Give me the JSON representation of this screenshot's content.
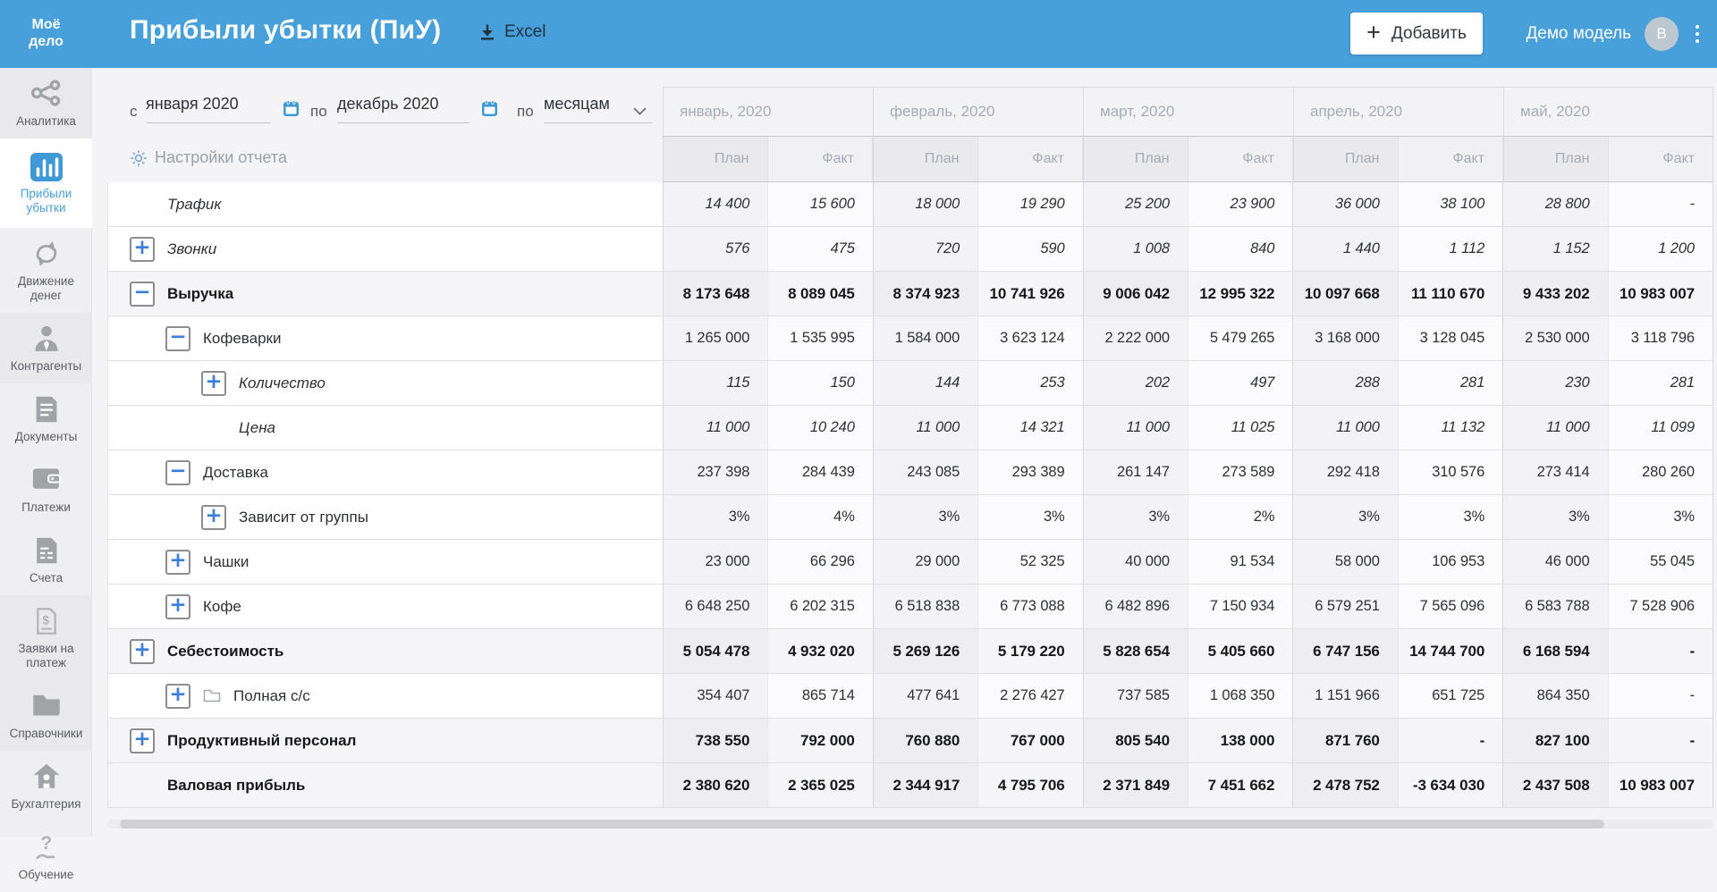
{
  "colors": {
    "header_blue": "#47a0d9",
    "active_blue": "#3f99d6",
    "control_blue": "#3b7fd9"
  },
  "header": {
    "logo_line1": "Моё",
    "logo_line2": "дело",
    "title": "Прибыли убытки (ПиУ)",
    "excel_label": "Excel",
    "add_button_label": "Добавить",
    "account_name": "Демо модель",
    "avatar_letter": "В"
  },
  "sidebar": {
    "items": [
      {
        "label": "Аналитика",
        "icon": "analytics-icon",
        "active": false,
        "tone": "dark"
      },
      {
        "label": "Прибыли убытки",
        "icon": "bar-chart-icon",
        "active": true,
        "tone": "light"
      },
      {
        "label": "Движение денег",
        "icon": "money-flow-icon",
        "active": false,
        "tone": "light"
      },
      {
        "label": "Контрагенты",
        "icon": "counterparty-icon",
        "active": false,
        "tone": "dark"
      },
      {
        "label": "Документы",
        "icon": "documents-icon",
        "active": false,
        "tone": "light"
      },
      {
        "label": "Платежи",
        "icon": "wallet-icon",
        "active": false,
        "tone": "light"
      },
      {
        "label": "Счета",
        "icon": "invoice-icon",
        "active": false,
        "tone": "light"
      },
      {
        "label": "Заявки на платеж",
        "icon": "payment-request-icon",
        "active": false,
        "tone": "dark"
      },
      {
        "label": "Справочники",
        "icon": "folder-icon",
        "active": false,
        "tone": "dark"
      },
      {
        "label": "Бухгалтерия",
        "icon": "accounting-icon",
        "active": false,
        "tone": "light"
      },
      {
        "label": "Обучение",
        "icon": "education-icon",
        "active": false,
        "tone": "light",
        "pinned_bottom": true
      }
    ]
  },
  "filters": {
    "from_label": "с",
    "from_value": "января 2020",
    "to_label": "по",
    "to_value": "декабрь 2020",
    "period_label": "по",
    "period_value": "месяцам",
    "settings_label": "Настройки отчета"
  },
  "table": {
    "months": [
      "январь, 2020",
      "февраль, 2020",
      "март, 2020",
      "апрель, 2020",
      "май, 2020"
    ],
    "subheaders": [
      "План",
      "Факт"
    ],
    "rows": [
      {
        "label": "Трафик",
        "level": 0,
        "expand": null,
        "italic": true,
        "bold": false,
        "folder": false,
        "values": [
          "14 400",
          "15 600",
          "18 000",
          "19 290",
          "25 200",
          "23 900",
          "36 000",
          "38 100",
          "28 800",
          "-"
        ]
      },
      {
        "label": "Звонки",
        "level": 0,
        "expand": "plus",
        "italic": true,
        "bold": false,
        "folder": false,
        "values": [
          "576",
          "475",
          "720",
          "590",
          "1 008",
          "840",
          "1 440",
          "1 112",
          "1 152",
          "1 200"
        ]
      },
      {
        "label": "Выручка",
        "level": 0,
        "expand": "minus",
        "italic": false,
        "bold": true,
        "folder": false,
        "values": [
          "8 173 648",
          "8 089 045",
          "8 374 923",
          "10 741 926",
          "9 006 042",
          "12 995 322",
          "10 097 668",
          "11 110 670",
          "9 433 202",
          "10 983 007"
        ]
      },
      {
        "label": "Кофеварки",
        "level": 1,
        "expand": "minus",
        "italic": false,
        "bold": false,
        "folder": false,
        "values": [
          "1 265 000",
          "1 535 995",
          "1 584 000",
          "3 623 124",
          "2 222 000",
          "5 479 265",
          "3 168 000",
          "3 128 045",
          "2 530 000",
          "3 118 796"
        ]
      },
      {
        "label": "Количество",
        "level": 2,
        "expand": "plus",
        "italic": true,
        "bold": false,
        "folder": false,
        "values": [
          "115",
          "150",
          "144",
          "253",
          "202",
          "497",
          "288",
          "281",
          "230",
          "281"
        ]
      },
      {
        "label": "Цена",
        "level": 2,
        "expand": null,
        "italic": true,
        "bold": false,
        "folder": false,
        "values": [
          "11 000",
          "10 240",
          "11 000",
          "14 321",
          "11 000",
          "11 025",
          "11 000",
          "11 132",
          "11 000",
          "11 099"
        ]
      },
      {
        "label": "Доставка",
        "level": 1,
        "expand": "minus",
        "italic": false,
        "bold": false,
        "folder": false,
        "values": [
          "237 398",
          "284 439",
          "243 085",
          "293 389",
          "261 147",
          "273 589",
          "292 418",
          "310 576",
          "273 414",
          "280 260"
        ]
      },
      {
        "label": "Зависит от группы",
        "level": 2,
        "expand": "plus",
        "italic": false,
        "bold": false,
        "folder": false,
        "values": [
          "3%",
          "4%",
          "3%",
          "3%",
          "3%",
          "2%",
          "3%",
          "3%",
          "3%",
          "3%"
        ]
      },
      {
        "label": "Чашки",
        "level": 1,
        "expand": "plus",
        "italic": false,
        "bold": false,
        "folder": false,
        "values": [
          "23 000",
          "66 296",
          "29 000",
          "52 325",
          "40 000",
          "91 534",
          "58 000",
          "106 953",
          "46 000",
          "55 045"
        ]
      },
      {
        "label": "Кофе",
        "level": 1,
        "expand": "plus",
        "italic": false,
        "bold": false,
        "folder": false,
        "values": [
          "6 648 250",
          "6 202 315",
          "6 518 838",
          "6 773 088",
          "6 482 896",
          "7 150 934",
          "6 579 251",
          "7 565 096",
          "6 583 788",
          "7 528 906"
        ]
      },
      {
        "label": "Себестоимость",
        "level": 0,
        "expand": "plus",
        "italic": false,
        "bold": true,
        "folder": false,
        "values": [
          "5 054 478",
          "4 932 020",
          "5 269 126",
          "5 179 220",
          "5 828 654",
          "5 405 660",
          "6 747 156",
          "14 744 700",
          "6 168 594",
          "-"
        ]
      },
      {
        "label": "Полная с/с",
        "level": 1,
        "expand": "plus",
        "italic": false,
        "bold": false,
        "folder": true,
        "values": [
          "354 407",
          "865 714",
          "477 641",
          "2 276 427",
          "737 585",
          "1 068 350",
          "1 151 966",
          "651 725",
          "864 350",
          "-"
        ]
      },
      {
        "label": "Продуктивный персонал",
        "level": 0,
        "expand": "plus",
        "italic": false,
        "bold": true,
        "folder": false,
        "values": [
          "738 550",
          "792 000",
          "760 880",
          "767 000",
          "805 540",
          "138 000",
          "871 760",
          "-",
          "827 100",
          "-"
        ]
      },
      {
        "label": "Валовая прибыль",
        "level": 0,
        "expand": null,
        "italic": false,
        "bold": true,
        "folder": false,
        "values": [
          "2 380 620",
          "2 365 025",
          "2 344 917",
          "4 795 706",
          "2 371 849",
          "7 451 662",
          "2 478 752",
          "-3 634 030",
          "2 437 508",
          "10 983 007"
        ]
      }
    ]
  }
}
